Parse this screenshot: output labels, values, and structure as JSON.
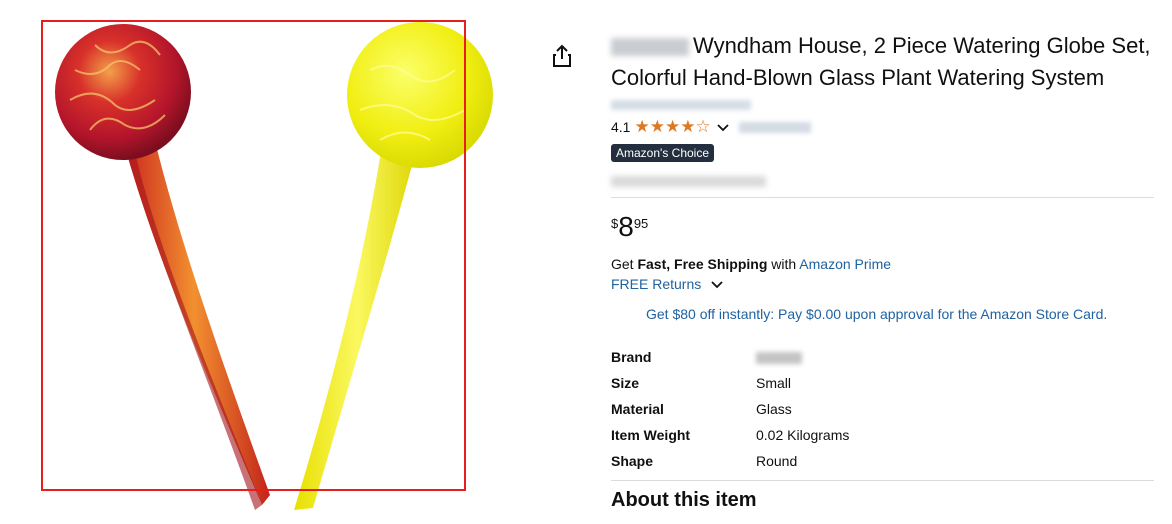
{
  "product": {
    "title": "Wyndham House, 2 Piece Watering Globe Set, Colorful Hand-Blown Glass Plant Watering System",
    "rating": "4.1",
    "stars": "★★★★☆",
    "badge": "Amazon's Choice",
    "price": {
      "symbol": "$",
      "whole": "8",
      "fraction": "95"
    },
    "shipping": {
      "prefix": "Get ",
      "bold": "Fast, Free Shipping",
      "mid": " with ",
      "link": "Amazon Prime"
    },
    "returns": "FREE Returns",
    "promo": "Get $80 off instantly: Pay $0.00 upon approval for the Amazon Store Card.",
    "about": "About this item"
  },
  "specs": [
    {
      "key": "Brand",
      "value": ""
    },
    {
      "key": "Size",
      "value": "Small"
    },
    {
      "key": "Material",
      "value": "Glass"
    },
    {
      "key": "Item Weight",
      "value": "0.02 Kilograms"
    },
    {
      "key": "Shape",
      "value": "Round"
    }
  ],
  "colors": {
    "star": "#de7921",
    "link": "#2162a1",
    "badge_bg": "#232f3e",
    "selection": "#e81e1e"
  },
  "icons": {
    "share": "share-icon",
    "chevron": "chevron-down-icon"
  }
}
